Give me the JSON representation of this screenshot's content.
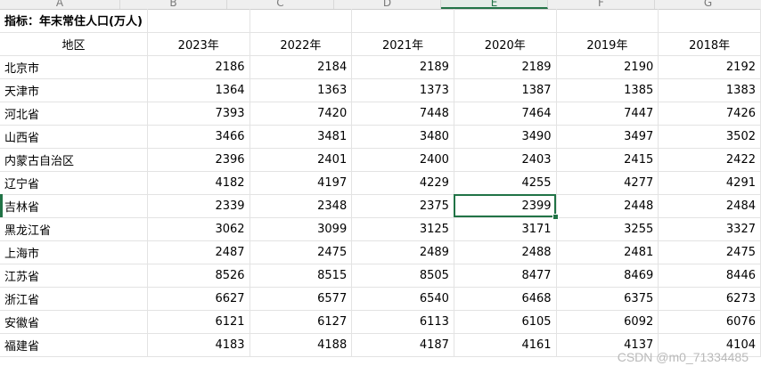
{
  "column_letters": [
    "A",
    "B",
    "C",
    "D",
    "E",
    "F",
    "G"
  ],
  "selected_column": "E",
  "title": "指标：年末常住人口(万人)",
  "header": {
    "region": "地区",
    "years": [
      "2023年",
      "2022年",
      "2021年",
      "2020年",
      "2019年",
      "2018年"
    ]
  },
  "active_cell": {
    "row": "吉林省",
    "year": "2020年"
  },
  "rows": [
    {
      "region": "北京市",
      "values": [
        "2186",
        "2184",
        "2189",
        "2189",
        "2190",
        "2192"
      ]
    },
    {
      "region": "天津市",
      "values": [
        "1364",
        "1363",
        "1373",
        "1387",
        "1385",
        "1383"
      ]
    },
    {
      "region": "河北省",
      "values": [
        "7393",
        "7420",
        "7448",
        "7464",
        "7447",
        "7426"
      ]
    },
    {
      "region": "山西省",
      "values": [
        "3466",
        "3481",
        "3480",
        "3490",
        "3497",
        "3502"
      ]
    },
    {
      "region": "内蒙古自治区",
      "values": [
        "2396",
        "2401",
        "2400",
        "2403",
        "2415",
        "2422"
      ]
    },
    {
      "region": "辽宁省",
      "values": [
        "4182",
        "4197",
        "4229",
        "4255",
        "4277",
        "4291"
      ]
    },
    {
      "region": "吉林省",
      "values": [
        "2339",
        "2348",
        "2375",
        "2399",
        "2448",
        "2484"
      ]
    },
    {
      "region": "黑龙江省",
      "values": [
        "3062",
        "3099",
        "3125",
        "3171",
        "3255",
        "3327"
      ]
    },
    {
      "region": "上海市",
      "values": [
        "2487",
        "2475",
        "2489",
        "2488",
        "2481",
        "2475"
      ]
    },
    {
      "region": "江苏省",
      "values": [
        "8526",
        "8515",
        "8505",
        "8477",
        "8469",
        "8446"
      ]
    },
    {
      "region": "浙江省",
      "values": [
        "6627",
        "6577",
        "6540",
        "6468",
        "6375",
        "6273"
      ]
    },
    {
      "region": "安徽省",
      "values": [
        "6121",
        "6127",
        "6113",
        "6105",
        "6092",
        "6076"
      ]
    },
    {
      "region": "福建省",
      "values": [
        "4183",
        "4188",
        "4187",
        "4161",
        "4137",
        "4104"
      ]
    }
  ],
  "watermark": "CSDN @m0_71334485"
}
